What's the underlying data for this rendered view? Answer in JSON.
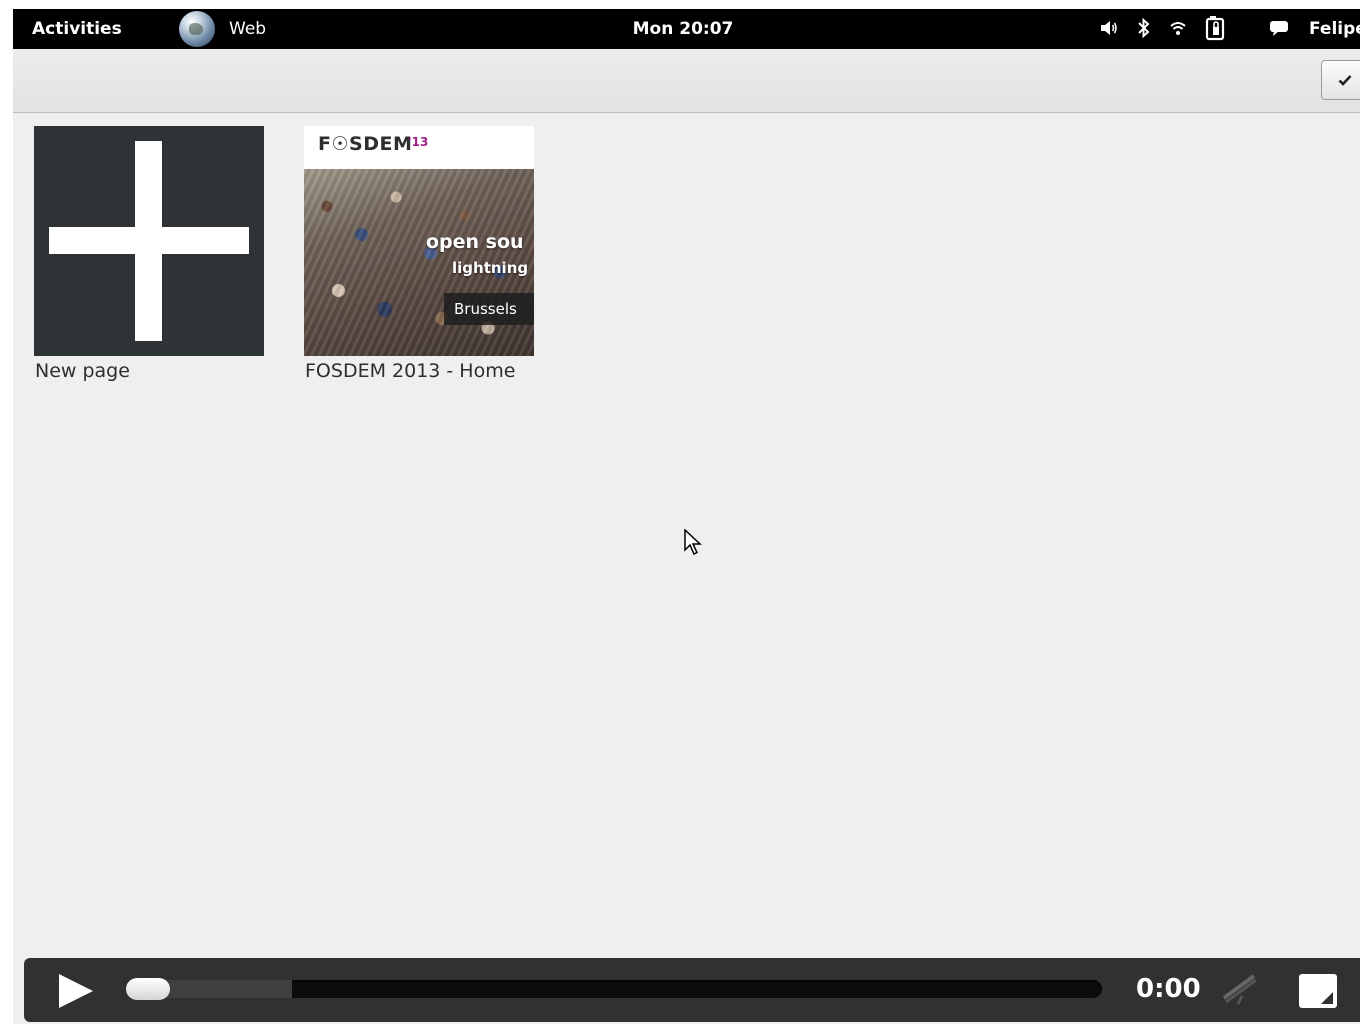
{
  "topbar": {
    "activities": "Activities",
    "app_name": "Web",
    "clock": "Mon 20:07",
    "user": "Felipe"
  },
  "overview": {
    "tiles": [
      {
        "title": "New page"
      },
      {
        "title": "FOSDEM 2013 - Home",
        "thumbnail": {
          "logo": "F☉SDEM",
          "year": "'13",
          "banner_line1": "open sou",
          "banner_line2": "lightning",
          "location": "Brussels"
        }
      }
    ]
  },
  "player": {
    "time": "0:00",
    "progress": 0.0,
    "buffered": 0.17
  },
  "colors": {
    "topbar": "#000000",
    "window_bg": "#efefef",
    "newpage_tile": "#2e3436",
    "controls_bg": "#2f3133",
    "fosdem_accent": "#a0208a"
  },
  "icons": [
    "globe-icon",
    "volume-icon",
    "bluetooth-icon",
    "wifi-icon",
    "battery-icon",
    "chat-icon",
    "checkmark-icon",
    "plus-icon",
    "play-icon",
    "mute-icon",
    "fullscreen-icon",
    "cursor-icon"
  ]
}
